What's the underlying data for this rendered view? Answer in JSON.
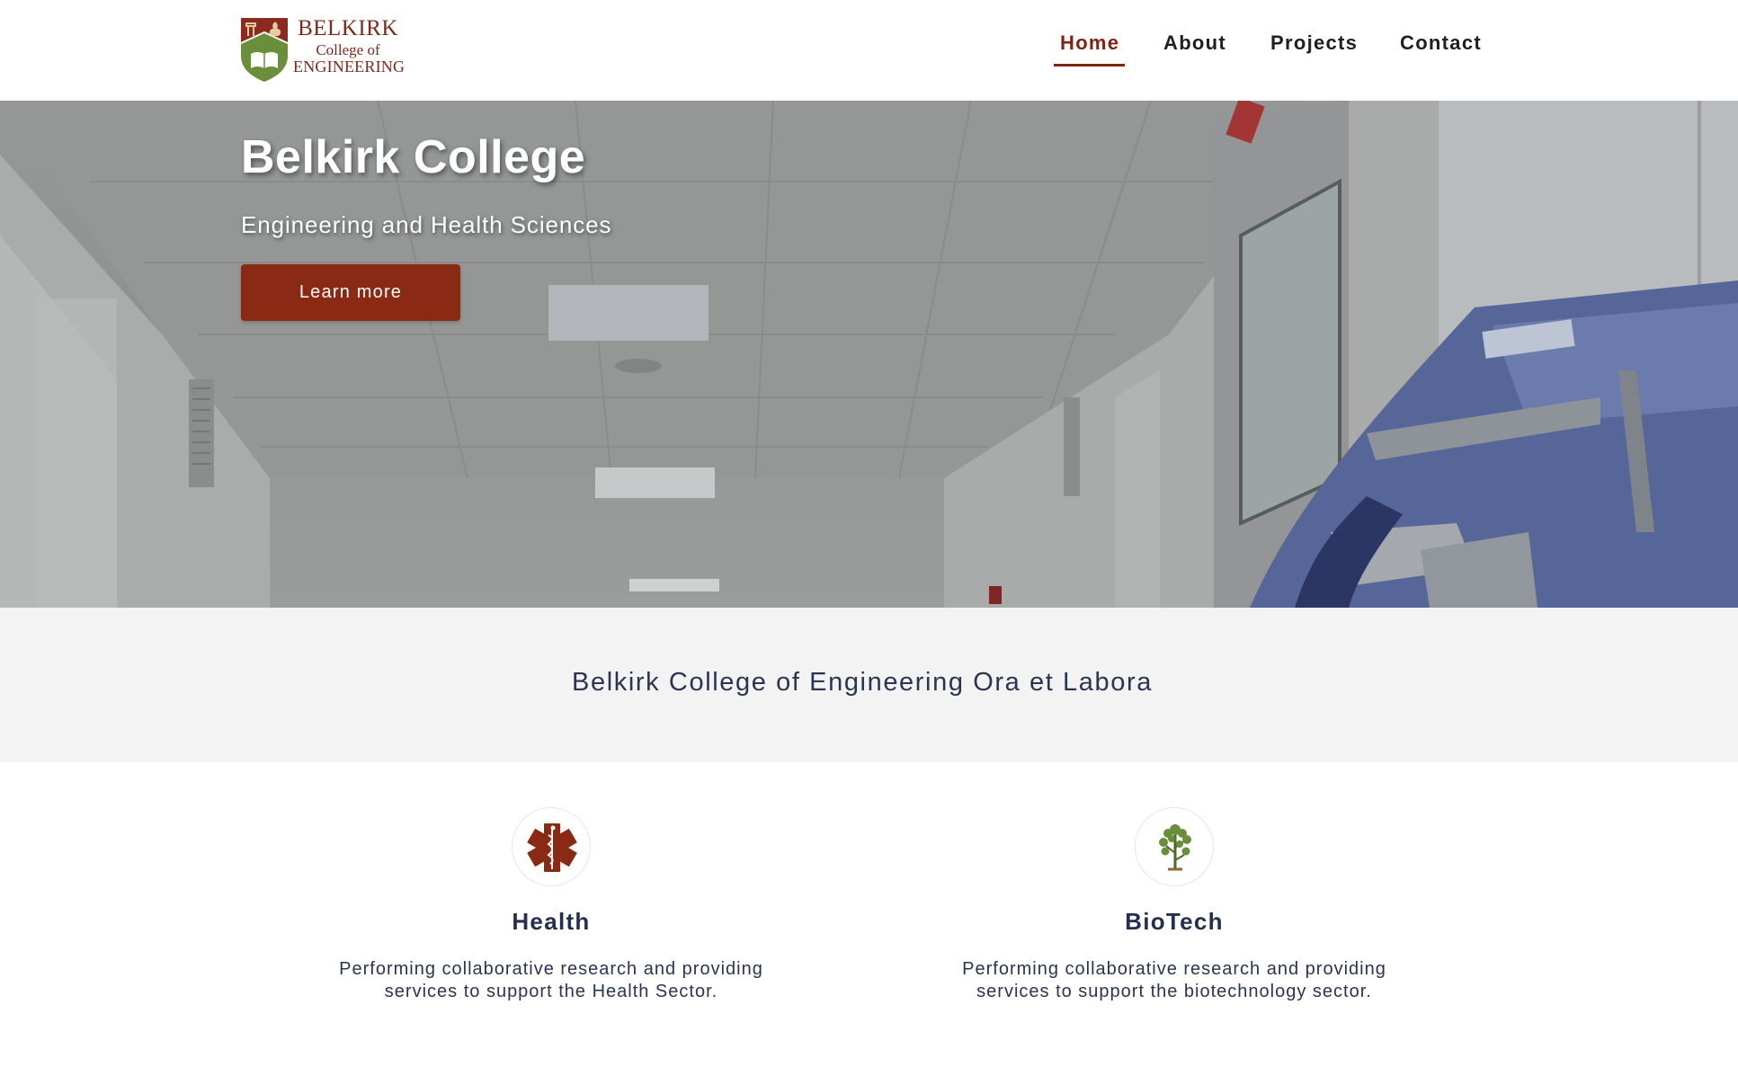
{
  "brand": {
    "name_line1": "BELKIRK",
    "name_line2": "College of",
    "name_line3": "ENGINEERING",
    "colors": {
      "maroon": "#7c2a1c",
      "shield_green": "#6b8e3a"
    }
  },
  "nav": {
    "items": [
      {
        "label": "Home",
        "active": true
      },
      {
        "label": "About",
        "active": false
      },
      {
        "label": "Projects",
        "active": false
      },
      {
        "label": "Contact",
        "active": false
      }
    ],
    "active_color": "#7f2412"
  },
  "hero": {
    "title": "Belkirk College",
    "subtitle": "Engineering and Health Sciences",
    "cta_label": "Learn more",
    "cta_color": "#8a2a14"
  },
  "motto": {
    "text": "Belkirk College of Engineering Ora et Labora"
  },
  "features": [
    {
      "icon": "medical-star-of-life-icon",
      "title": "Health",
      "description": "Performing collaborative research and providing services to support the Health Sector."
    },
    {
      "icon": "plant-tree-icon",
      "title": "BioTech",
      "description": "Performing collaborative research and providing services to support the biotechnology sector."
    }
  ]
}
